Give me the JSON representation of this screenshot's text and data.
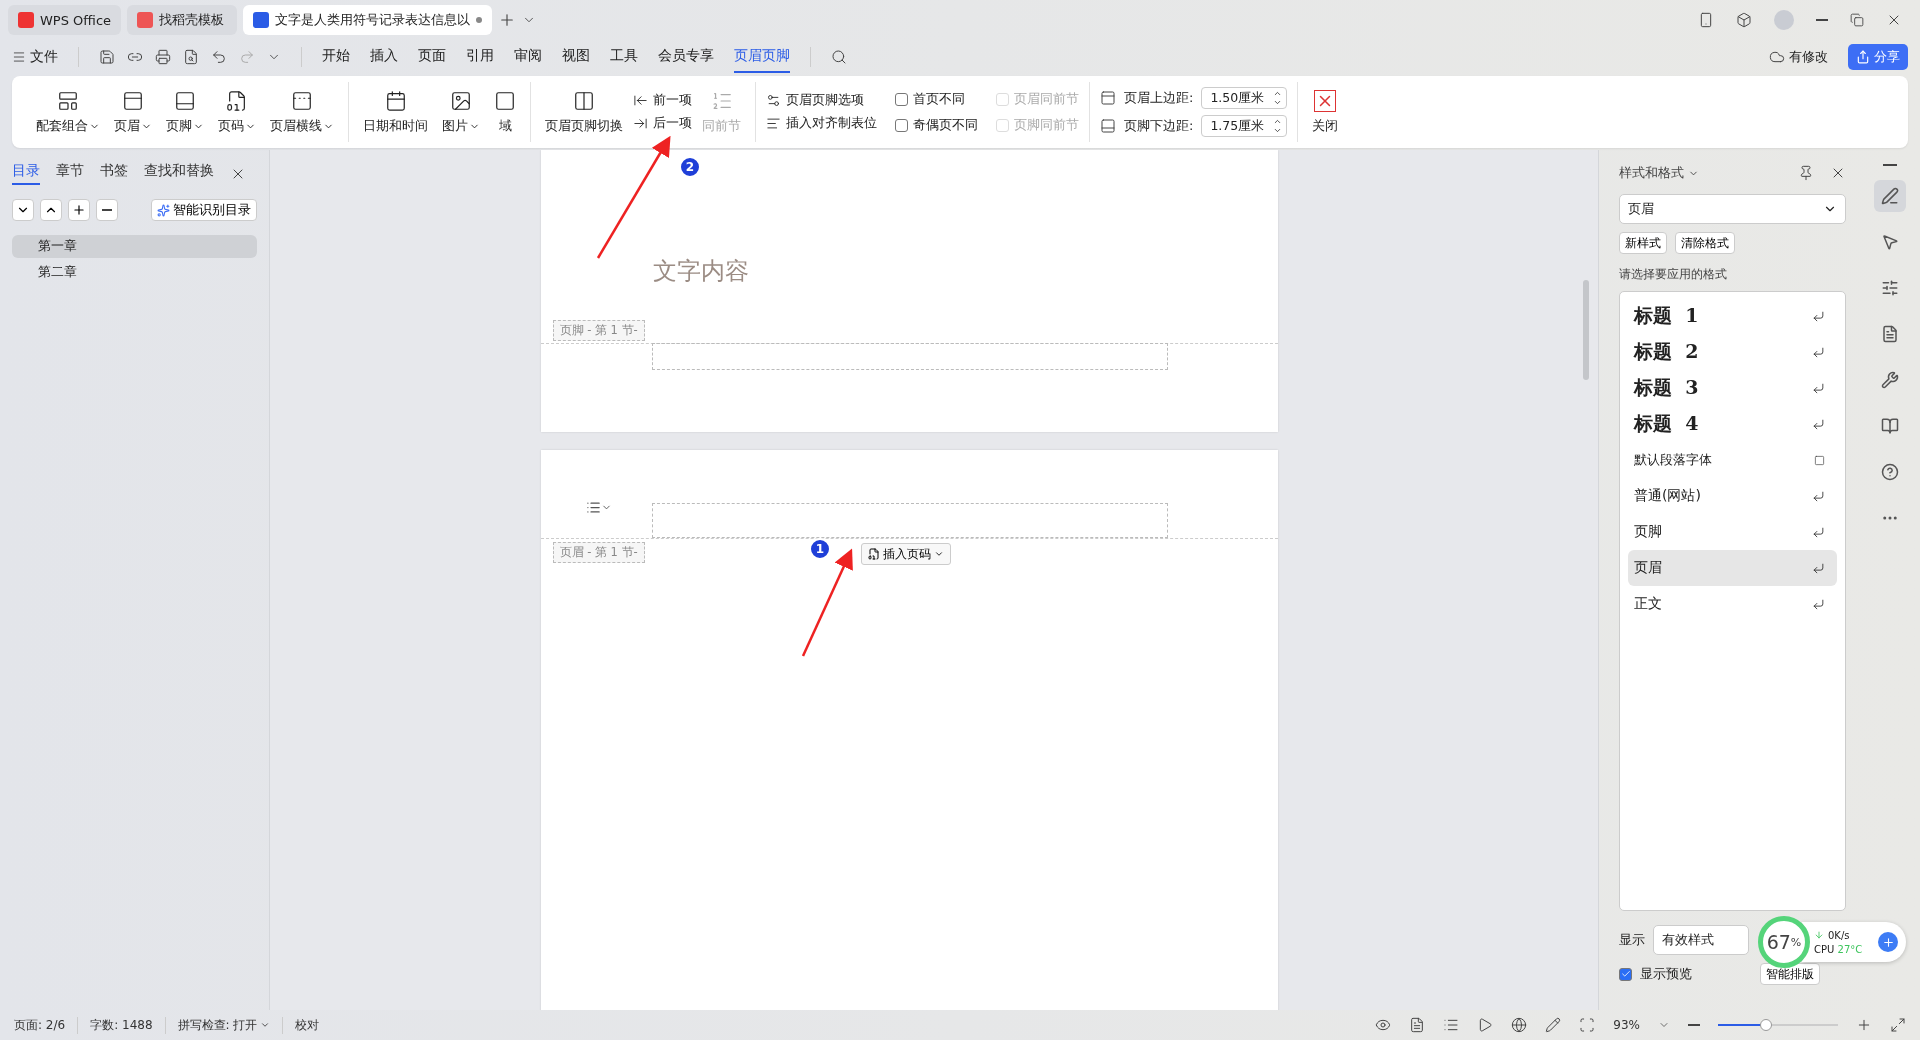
{
  "tabs": [
    {
      "kind": "home",
      "label": "WPS Office",
      "selected": false
    },
    {
      "kind": "template",
      "label": "找稻壳模板",
      "selected": false
    },
    {
      "kind": "doc",
      "label": "文字是人类用符号记录表达信息以",
      "selected": true,
      "unsaved": true
    }
  ],
  "menu": {
    "file": "文件",
    "items": [
      {
        "label": "开始",
        "selected": false
      },
      {
        "label": "插入",
        "selected": false
      },
      {
        "label": "页面",
        "selected": false
      },
      {
        "label": "引用",
        "selected": false
      },
      {
        "label": "审阅",
        "selected": false
      },
      {
        "label": "视图",
        "selected": false
      },
      {
        "label": "工具",
        "selected": false
      },
      {
        "label": "会员专享",
        "selected": false
      },
      {
        "label": "页眉页脚",
        "selected": true
      }
    ],
    "modified": "有修改",
    "share": "分享"
  },
  "ribbon": {
    "group_1": [
      {
        "label": "配套组合",
        "dropdown": true
      },
      {
        "label": "页眉",
        "dropdown": true
      },
      {
        "label": "页脚",
        "dropdown": true
      },
      {
        "label": "页码",
        "dropdown": true
      },
      {
        "label": "页眉横线",
        "dropdown": true
      }
    ],
    "group_2": [
      {
        "label": "日期和时间",
        "dropdown": false
      },
      {
        "label": "图片",
        "dropdown": true
      },
      {
        "label": "域",
        "dropdown": false
      }
    ],
    "switch": {
      "label": "页眉页脚切换"
    },
    "nav": [
      {
        "label": "前一项"
      },
      {
        "label": "后一项"
      }
    ],
    "link_previous": {
      "label": "同前节",
      "disabled": true
    },
    "options": [
      {
        "label": "页眉页脚选项"
      },
      {
        "label": "插入对齐制表位"
      }
    ],
    "checkboxes": [
      {
        "label": "首页不同",
        "checked": false,
        "disabled": false
      },
      {
        "label": "页眉同前节",
        "checked": false,
        "disabled": true
      },
      {
        "label": "奇偶页不同",
        "checked": false,
        "disabled": false
      },
      {
        "label": "页脚同前节",
        "checked": false,
        "disabled": true
      }
    ],
    "margins": [
      {
        "label": "页眉上边距:",
        "value": "1.50厘米"
      },
      {
        "label": "页脚下边距:",
        "value": "1.75厘米"
      }
    ],
    "close": "关闭"
  },
  "nav_panel": {
    "tabs": [
      {
        "label": "目录",
        "selected": true
      },
      {
        "label": "章节",
        "selected": false
      },
      {
        "label": "书签",
        "selected": false
      },
      {
        "label": "查找和替换",
        "selected": false
      }
    ],
    "smart_toc": "智能识别目录",
    "outline": [
      {
        "label": "第一章",
        "selected": true
      },
      {
        "label": "第二章",
        "selected": false
      }
    ]
  },
  "document": {
    "page_1": {
      "text": "文字内容",
      "footer_label": "页脚 - 第 1 节-"
    },
    "page_2": {
      "header_label": "页眉 - 第 1 节-",
      "insert_page_number": "插入页码"
    },
    "markers": [
      "2",
      "1"
    ]
  },
  "styles_panel": {
    "title": "样式和格式",
    "current": "页眉",
    "new_style": "新样式",
    "clear_format": "清除格式",
    "hint": "请选择要应用的格式",
    "styles": [
      {
        "label": "标题  1",
        "kind": "heading",
        "selected": false
      },
      {
        "label": "标题  2",
        "kind": "heading",
        "selected": false
      },
      {
        "label": "标题  3",
        "kind": "heading",
        "selected": false
      },
      {
        "label": "标题  4",
        "kind": "heading",
        "selected": false
      },
      {
        "label": "默认段落字体",
        "kind": "character",
        "selected": false
      },
      {
        "label": "普通(网站)",
        "kind": "paragraph",
        "selected": false
      },
      {
        "label": "页脚",
        "kind": "paragraph",
        "selected": false
      },
      {
        "label": "页眉",
        "kind": "paragraph",
        "selected": true
      },
      {
        "label": "正文",
        "kind": "paragraph",
        "selected": false
      }
    ],
    "show_label": "显示",
    "show_value": "有效样式",
    "preview": {
      "label": "显示预览",
      "checked": true
    },
    "smart_layout": "智能排版"
  },
  "monitor": {
    "percent": "67",
    "percent_sign": "%",
    "speed": "0K/s",
    "cpu": "CPU",
    "temp": "27°C"
  },
  "status_bar": {
    "page": "页面: 2/6",
    "words": "字数: 1488",
    "spell": "拼写检查: 打开",
    "proof": "校对",
    "zoom": "93%",
    "zoom_slider": {
      "level": 0.4
    }
  }
}
